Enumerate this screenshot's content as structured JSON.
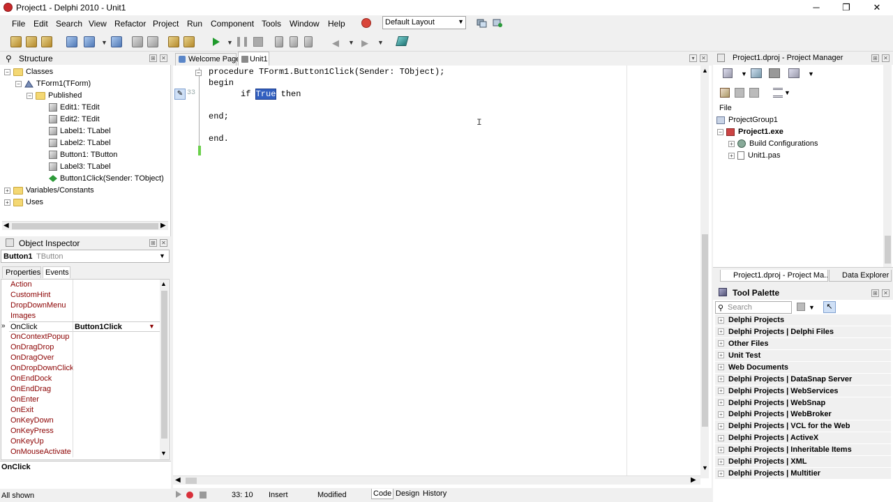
{
  "window": {
    "title": "Project1 - Delphi 2010 - Unit1",
    "minimize": "─",
    "restore": "❐",
    "close": "✕"
  },
  "menu": [
    "File",
    "Edit",
    "Search",
    "View",
    "Refactor",
    "Project",
    "Run",
    "Component",
    "Tools",
    "Window",
    "Help"
  ],
  "toolbar": {
    "layout_value": "Default Layout"
  },
  "structure": {
    "title": "Structure",
    "items": [
      {
        "label": "Classes"
      },
      {
        "label": "TForm1(TForm)"
      },
      {
        "label": "Published"
      },
      {
        "label": "Edit1: TEdit"
      },
      {
        "label": "Edit2: TEdit"
      },
      {
        "label": "Label1: TLabel"
      },
      {
        "label": "Label2: TLabel"
      },
      {
        "label": "Button1: TButton"
      },
      {
        "label": "Label3: TLabel"
      },
      {
        "label": "Button1Click(Sender: TObject)"
      },
      {
        "label": "Variables/Constants"
      },
      {
        "label": "Uses"
      }
    ]
  },
  "inspector": {
    "title": "Object Inspector",
    "object_name": "Button1",
    "object_type": "TButton",
    "tabs": [
      "Properties",
      "Events"
    ],
    "events": [
      {
        "name": "Action",
        "value": ""
      },
      {
        "name": "CustomHint",
        "value": ""
      },
      {
        "name": "DropDownMenu",
        "value": ""
      },
      {
        "name": "Images",
        "value": ""
      },
      {
        "name": "OnClick",
        "value": "Button1Click"
      },
      {
        "name": "OnContextPopup",
        "value": ""
      },
      {
        "name": "OnDragDrop",
        "value": ""
      },
      {
        "name": "OnDragOver",
        "value": ""
      },
      {
        "name": "OnDropDownClick",
        "value": ""
      },
      {
        "name": "OnEndDock",
        "value": ""
      },
      {
        "name": "OnEndDrag",
        "value": ""
      },
      {
        "name": "OnEnter",
        "value": ""
      },
      {
        "name": "OnExit",
        "value": ""
      },
      {
        "name": "OnKeyDown",
        "value": ""
      },
      {
        "name": "OnKeyPress",
        "value": ""
      },
      {
        "name": "OnKeyUp",
        "value": ""
      },
      {
        "name": "OnMouseActivate",
        "value": ""
      }
    ],
    "selected_desc": "OnClick",
    "footer": "All shown"
  },
  "editor": {
    "tabs": [
      "Welcome Page",
      "Unit1"
    ],
    "lines": {
      "l1": "procedure TForm1.Button1Click(Sender: TObject);",
      "l2": "begin",
      "l3_pre": "if ",
      "l3_sel": "True",
      "l3_post": " then",
      "l5": "end;",
      "l7": "end."
    },
    "gutter_line": "33",
    "status": {
      "position": "33:  10",
      "mode": "Insert",
      "state": "Modified",
      "view_tabs": [
        "Code",
        "Design",
        "History"
      ]
    }
  },
  "project_manager": {
    "title": "Project1.dproj - Project Manager",
    "file_header": "File",
    "items": [
      {
        "label": "ProjectGroup1"
      },
      {
        "label": "Project1.exe"
      },
      {
        "label": "Build Configurations"
      },
      {
        "label": "Unit1.pas"
      }
    ],
    "bottom_tabs": [
      "Project1.dproj - Project Ma...",
      "Data Explorer"
    ]
  },
  "tool_palette": {
    "title": "Tool Palette",
    "search_placeholder": "Search",
    "categories": [
      "Delphi Projects",
      "Delphi Projects | Delphi Files",
      "Other Files",
      "Unit Test",
      "Web Documents",
      "Delphi Projects | DataSnap Server",
      "Delphi Projects | WebServices",
      "Delphi Projects | WebSnap",
      "Delphi Projects | WebBroker",
      "Delphi Projects | VCL for the Web",
      "Delphi Projects | ActiveX",
      "Delphi Projects | Inheritable Items",
      "Delphi Projects | XML",
      "Delphi Projects | Multitier"
    ]
  },
  "colors": {
    "selection": "#3260c0",
    "accent_red": "#c8282b",
    "event_name": "#8b0000"
  }
}
